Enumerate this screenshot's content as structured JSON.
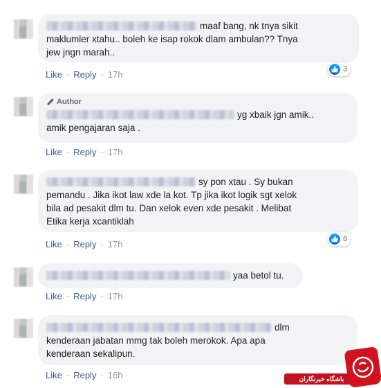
{
  "actions": {
    "like": "Like",
    "reply": "Reply",
    "sep": "·"
  },
  "author_label": "Author",
  "comments": [
    {
      "line1": "maaf bang, nk tnya sikit",
      "line2": "maklumler xtahu.. boleh ke isap rokok dlam ambulan?? Tnya",
      "line3": "jew jngn marah..",
      "time": "17h",
      "reactions": "3"
    },
    {
      "line1": "yg xbaik jgn amik..",
      "line2": "amik pengajaran saja .",
      "time": "17h"
    },
    {
      "line1": "sy pon xtau . Sy bukan",
      "line2": "pemandu . Jika ikot law xde la kot. Tp jika ikot logik sgt xelok",
      "line3": "bila ad pesakit dlm tu. Dan xelok even xde pesakit . Melibat",
      "line4": "Etika kerja xcantiklah",
      "time": "17h",
      "reactions": "6"
    },
    {
      "line1": "yaa betol tu.",
      "time": "17h"
    },
    {
      "line1": "dlm",
      "line2": "kenderaan jabatan mmg tak boleh merokok. Apa apa",
      "line3": "kenderaan sekalipun.",
      "time": "16h"
    }
  ],
  "watermark": {
    "text": "باشگاه خبرنگاران"
  },
  "colors": {
    "bubble": "#f2f3f5",
    "link": "#385898",
    "meta": "#90949c",
    "like": "#1877f2",
    "watermark": "#c1121f"
  }
}
